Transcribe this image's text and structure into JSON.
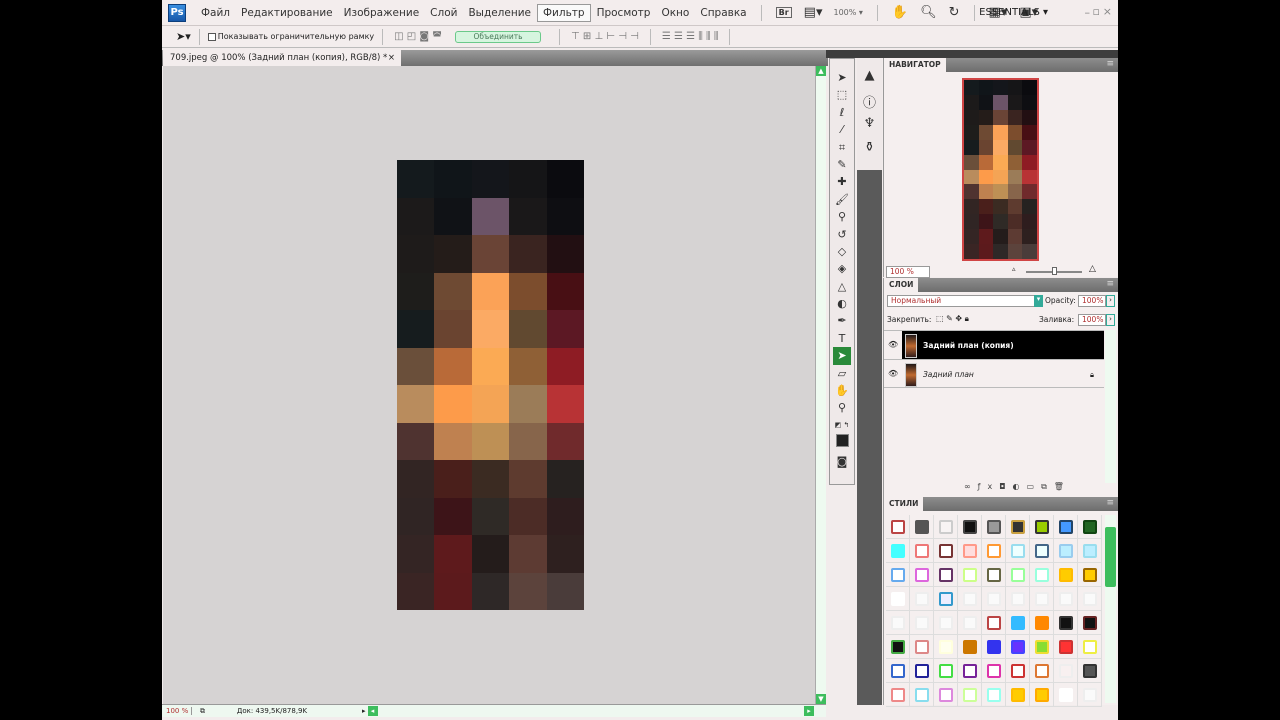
{
  "app": {
    "logo": "Ps"
  },
  "menu": [
    "Файл",
    "Редактирование",
    "Изображение",
    "Слой",
    "Выделение",
    "Фильтр",
    "Просмотр",
    "Окно",
    "Справка"
  ],
  "menu_active": 5,
  "appbar": {
    "bridge": "Br",
    "zoom": "100% ▾",
    "workspace": "ESSENTIALS ▾",
    "minimize": "–",
    "restore": "▫",
    "close": "×"
  },
  "options": {
    "show_bounds": "Показывать ограничительную рамку",
    "merge": "Объединить"
  },
  "document": {
    "tab_title": "709.jpeg @ 100% (Задний план (копия), RGB/8) *",
    "close": "×"
  },
  "status": {
    "zoom": "100 %",
    "doc": "Док: 439,5K/878,9K"
  },
  "navigator": {
    "title": "НАВИГАТОР",
    "zoom": "100 %"
  },
  "layers": {
    "title": "СЛОИ",
    "blend_mode": "Нормальный",
    "opacity_label": "Opacity:",
    "opacity": "100%",
    "lock_label": "Закрепить:",
    "fill_label": "Заливка:",
    "fill": "100%",
    "items": [
      {
        "name": "Задний план (копия)",
        "selected": true
      },
      {
        "name": "Задний план",
        "selected": false,
        "locked": true
      }
    ]
  },
  "styles": {
    "title": "СТИЛИ"
  },
  "pixels": [
    "#141a1d",
    "#101519",
    "#14161b",
    "#151517",
    "#0b0b0f",
    "#1c1a1a",
    "#101216",
    "#6c5468",
    "#1a1819",
    "#0e0e12",
    "#1e1b1a",
    "#241c19",
    "#6a4436",
    "#3a2420",
    "#220f12",
    "#1e1d1b",
    "#6e4a33",
    "#fba257",
    "#7c4d2d",
    "#480f14",
    "#161c1e",
    "#6a4430",
    "#fbaa64",
    "#614930",
    "#5c1824",
    "#6a4f3a",
    "#b96a38",
    "#fbaa54",
    "#8f6036",
    "#8e1c24",
    "#b98c5d",
    "#fd9b4a",
    "#f4a455",
    "#9b7c58",
    "#b83335",
    "#4f3330",
    "#bf8150",
    "#be9055",
    "#87654b",
    "#702a2c",
    "#322523",
    "#4a1f1b",
    "#3b2b22",
    "#5e3b2f",
    "#262220",
    "#302524",
    "#3d1418",
    "#2f2a26",
    "#4c2c26",
    "#2e1d1e",
    "#342524",
    "#5e1a1c",
    "#241c1b",
    "#5d3b33",
    "#2e201f",
    "#3a2524",
    "#5c1a1c",
    "#2e2827",
    "#5c433c",
    "#4a3c3a"
  ],
  "style_swatches": [
    [
      "#fff",
      "#b44"
    ],
    [
      "#555",
      "#555"
    ],
    [
      "#f8f4f4",
      "#ccc"
    ],
    [
      "#111",
      "#444"
    ],
    [
      "#999",
      "#555"
    ],
    [
      "#333",
      "#c9a040"
    ],
    [
      "#9c0",
      "#333"
    ],
    [
      "#49f",
      "#246"
    ],
    [
      "#262",
      "#141"
    ],
    [
      "#4ff",
      "#4ff"
    ],
    [
      "#fff",
      "#e77"
    ],
    [
      "#fff",
      "#733"
    ],
    [
      "#fdd",
      "#f98"
    ],
    [
      "#fff",
      "#f93"
    ],
    [
      "#eff",
      "#9de"
    ],
    [
      "#eff",
      "#468"
    ],
    [
      "#bef",
      "#9ce"
    ],
    [
      "#bef",
      "#9de"
    ],
    [
      "#fff",
      "#6ae"
    ],
    [
      "#fff",
      "#d6d"
    ],
    [
      "#fff",
      "#636"
    ],
    [
      "#fff",
      "#cf8"
    ],
    [
      "#fff",
      "#664"
    ],
    [
      "#fff",
      "#9f9"
    ],
    [
      "#fff",
      "#9fd"
    ],
    [
      "#fc0",
      "#fb0"
    ],
    [
      "#fc0",
      "#960"
    ],
    [
      "#fff",
      "#fff"
    ],
    [
      "#fafafa",
      "#eee"
    ],
    [
      "#eef",
      "#39c"
    ],
    [
      "#fafafa",
      "#eee"
    ],
    [
      "#fafafa",
      "#eee"
    ],
    [
      "#fafafa",
      "#eee"
    ],
    [
      "#fafafa",
      "#eee"
    ],
    [
      "#fafafa",
      "#eee"
    ],
    [
      "#fafafa",
      "#eee"
    ],
    [
      "#fafafa",
      "#eee"
    ],
    [
      "#fafafa",
      "#eee"
    ],
    [
      "#fafafa",
      "#eee"
    ],
    [
      "#fafafa",
      "#eee"
    ],
    [
      "#fff",
      "#b44"
    ],
    [
      "#3bf",
      "#3bf"
    ],
    [
      "#f80",
      "#f80"
    ],
    [
      "#111",
      "#333"
    ],
    [
      "#111",
      "#622"
    ],
    [
      "#111",
      "#4a4"
    ],
    [
      "#fff",
      "#d88"
    ],
    [
      "#ffe",
      "#ffd"
    ],
    [
      "#c70",
      "#c70"
    ],
    [
      "#33e",
      "#33e"
    ],
    [
      "#63f",
      "#44f"
    ],
    [
      "#8d3",
      "#ed3"
    ],
    [
      "#f33",
      "#c33"
    ],
    [
      "#fff",
      "#ee4"
    ],
    [
      "#fff",
      "#36c"
    ],
    [
      "#fff",
      "#229"
    ],
    [
      "#fff",
      "#4d4"
    ],
    [
      "#fff",
      "#729"
    ],
    [
      "#fff",
      "#d3a"
    ],
    [
      "#fff",
      "#c33"
    ],
    [
      "#fff",
      "#d73"
    ],
    [
      "#f8f0f0",
      "#eee"
    ],
    [
      "#555",
      "#333"
    ],
    [
      "#fff",
      "#e88"
    ],
    [
      "#fff",
      "#8de"
    ],
    [
      "#fff",
      "#d8d"
    ],
    [
      "#fff",
      "#cf9"
    ],
    [
      "#fff",
      "#9fe"
    ],
    [
      "#fc0",
      "#fb0"
    ],
    [
      "#fc0",
      "#fa0"
    ],
    [
      "#fff",
      "#fff"
    ],
    [
      "#fafafa",
      "#eee"
    ]
  ]
}
